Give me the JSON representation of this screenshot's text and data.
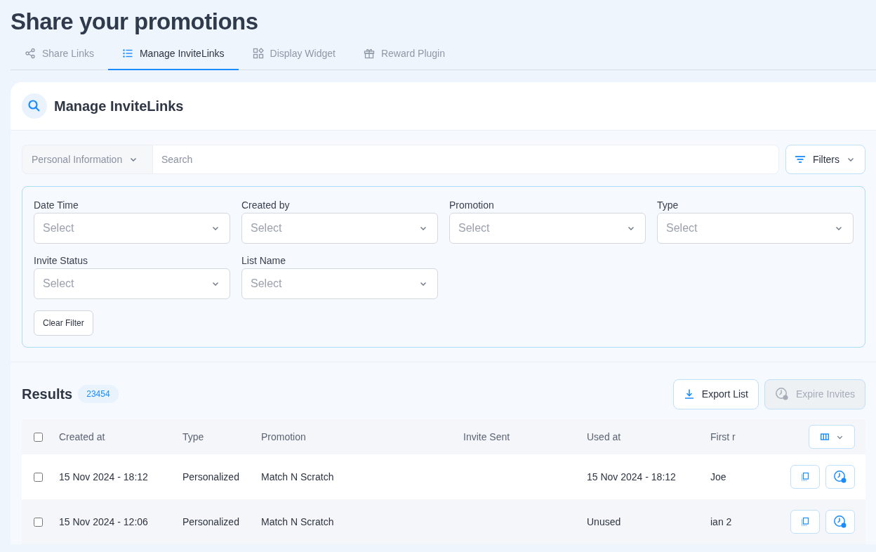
{
  "page_title": "Share your promotions",
  "tabs": [
    {
      "label": "Share Links",
      "selected": false
    },
    {
      "label": "Manage InviteLinks",
      "selected": true
    },
    {
      "label": "Display Widget",
      "selected": false
    },
    {
      "label": "Reward Plugin",
      "selected": false
    }
  ],
  "card_title": "Manage InviteLinks",
  "search": {
    "scope": "Personal Information",
    "placeholder": "Search"
  },
  "filters_button": "Filters",
  "filters": [
    {
      "label": "Date Time",
      "placeholder": "Select"
    },
    {
      "label": "Created by",
      "placeholder": "Select"
    },
    {
      "label": "Promotion",
      "placeholder": "Select"
    },
    {
      "label": "Type",
      "placeholder": "Select"
    },
    {
      "label": "Invite Status",
      "placeholder": "Select"
    },
    {
      "label": "List Name",
      "placeholder": "Select"
    }
  ],
  "clear_filter": "Clear Filter",
  "results": {
    "title": "Results",
    "count": "23454"
  },
  "export_button": {
    "label": "Export List",
    "disabled": false
  },
  "expire_button": {
    "label": "Expire Invites",
    "disabled": true
  },
  "table": {
    "select_all": {
      "checked": false
    },
    "columns": [
      "Created at",
      "Type",
      "Promotion",
      "Invite Sent",
      "Used at",
      "First r"
    ],
    "rows": [
      {
        "checked": false,
        "cells": [
          "15 Nov 2024 - 18:12",
          "Personalized",
          "Match N Scratch",
          "",
          "15 Nov 2024 - 18:12",
          "Joe"
        ]
      },
      {
        "checked": false,
        "cells": [
          "15 Nov 2024 - 12:06",
          "Personalized",
          "Match N Scratch",
          "",
          "Unused",
          "ian 2"
        ]
      }
    ]
  }
}
